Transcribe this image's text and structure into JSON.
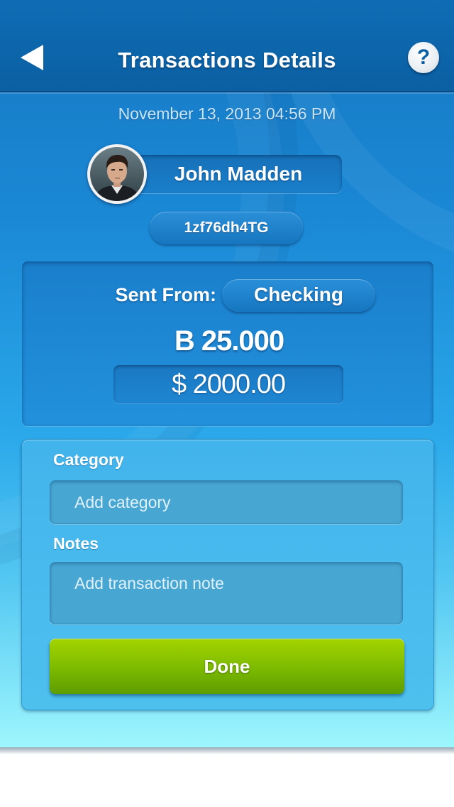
{
  "nav": {
    "title": "Transactions Details",
    "back_icon": "back-arrow-icon",
    "help_icon": "help-icon",
    "help_label": "?"
  },
  "transaction": {
    "date": "November 13, 2013 04:56 PM",
    "contact_name": "John Madden",
    "transaction_id": "1zf76dh4TG",
    "sent_from_label": "Sent From:",
    "account": "Checking",
    "btc_amount": "B 25.000",
    "usd_amount": "$ 2000.00"
  },
  "form": {
    "category_label": "Category",
    "category_placeholder": "Add category",
    "notes_label": "Notes",
    "notes_placeholder": "Add transaction note",
    "done_label": "Done"
  },
  "colors": {
    "nav_bg": "#0f6db5",
    "panel_bg": "#1a7fcc",
    "form_bg": "#42b4ec",
    "done_green": "#7fbc00"
  }
}
